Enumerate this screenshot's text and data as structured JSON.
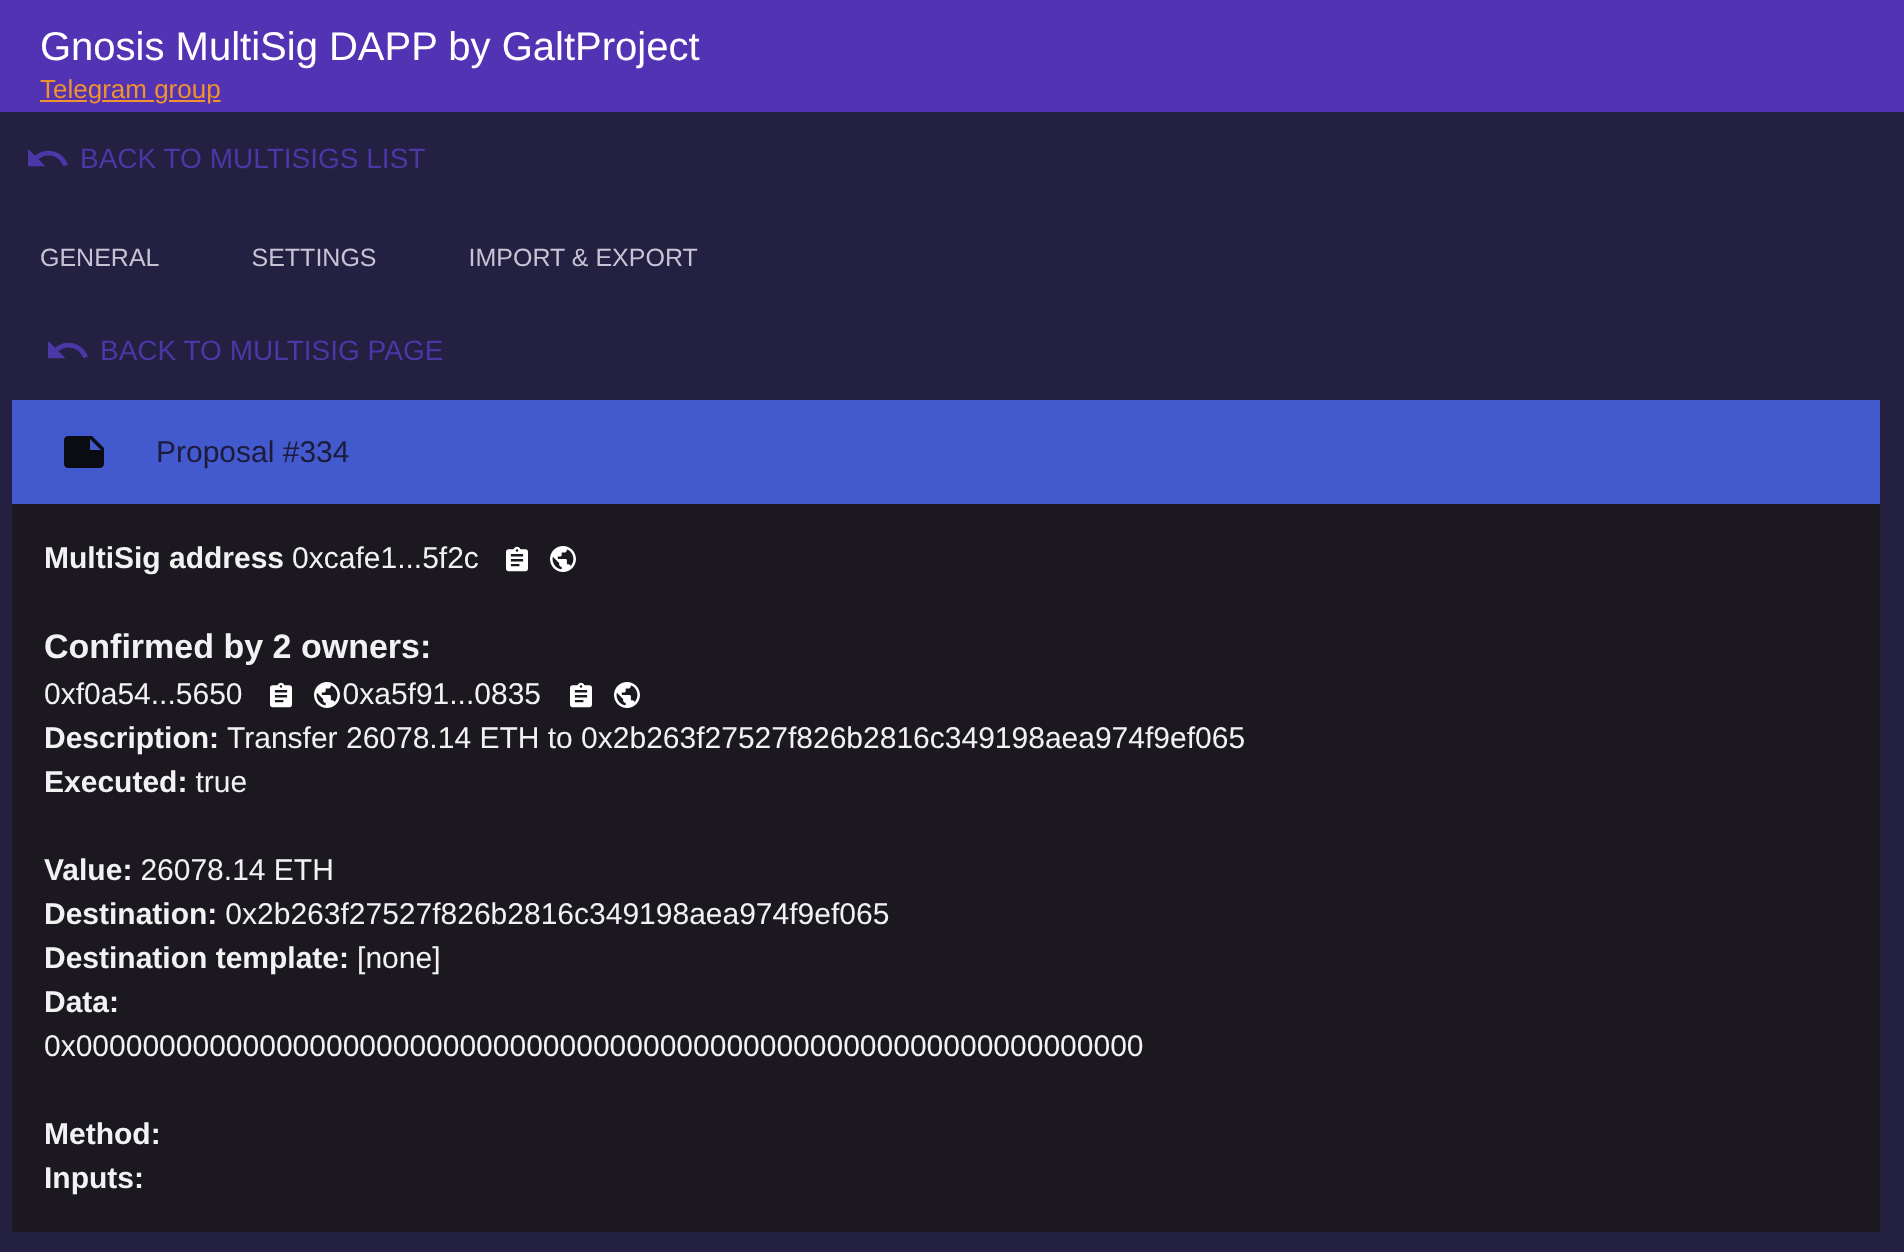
{
  "header": {
    "title": "Gnosis MultiSig DAPP by GaltProject",
    "link": "Telegram group"
  },
  "back_to_list": {
    "label": "BACK TO MULTISIGS LIST"
  },
  "tabs": [
    {
      "label": "GENERAL"
    },
    {
      "label": "SETTINGS"
    },
    {
      "label": "IMPORT & EXPORT"
    }
  ],
  "back_to_page": {
    "label": "BACK TO MULTISIG PAGE"
  },
  "proposal": {
    "title": "Proposal #334",
    "multisig_address": {
      "label": "MultiSig address",
      "value": "0xcafe1...5f2c"
    },
    "confirmed_heading": "Confirmed by 2 owners:",
    "owners": [
      "0xf0a54...5650",
      "0xa5f91...0835"
    ],
    "field_groups": [
      {
        "fields": [
          {
            "kind": "inline",
            "label": "Description:",
            "value": "Transfer 26078.14 ETH to 0x2b263f27527f826b2816c349198aea974f9ef065"
          },
          {
            "kind": "inline",
            "label": "Executed:",
            "value": "true"
          }
        ]
      },
      {
        "fields": [
          {
            "kind": "inline",
            "label": "Value:",
            "value": "26078.14 ETH"
          },
          {
            "kind": "inline",
            "label": "Destination:",
            "value": "0x2b263f27527f826b2816c349198aea974f9ef065"
          },
          {
            "kind": "inline",
            "label": "Destination template:",
            "value": "[none]"
          },
          {
            "kind": "block",
            "label": "Data:",
            "value": "0x0000000000000000000000000000000000000000000000000000000000000000"
          }
        ]
      },
      {
        "fields": [
          {
            "kind": "inline",
            "label": "Method:"
          },
          {
            "kind": "inline",
            "label": "Inputs:"
          }
        ]
      }
    ]
  }
}
